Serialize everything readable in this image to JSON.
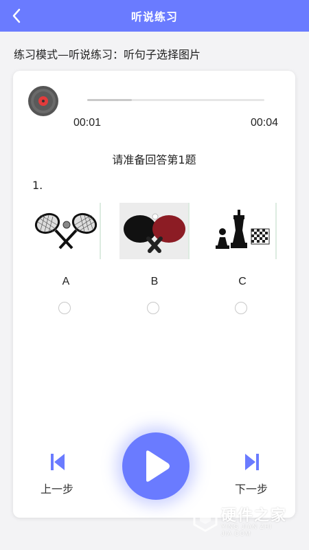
{
  "header": {
    "title": "听说练习",
    "back_icon": "chevron-left-icon",
    "background": "#6a7bff"
  },
  "mode_text": "练习模式—听说练习：听句子选择图片",
  "player": {
    "current_time": "00:01",
    "total_time": "00:04",
    "progress_fraction": 0.25,
    "record_icon": "vinyl-record-icon"
  },
  "question": {
    "prompt": "请准备回答第1题",
    "number": "1.",
    "options": [
      {
        "label": "A",
        "image": "tennis-rackets-icon",
        "selected": false
      },
      {
        "label": "B",
        "image": "ping-pong-paddles-icon",
        "selected": false
      },
      {
        "label": "C",
        "image": "chess-pieces-icon",
        "selected": false
      }
    ]
  },
  "controls": {
    "prev_label": "上一步",
    "next_label": "下一步",
    "play_icon": "play-icon",
    "accent": "#6a7bff"
  },
  "watermark": {
    "title": "硬件之家",
    "subtitle": "YING JIAN ZHI JIA.COM"
  }
}
